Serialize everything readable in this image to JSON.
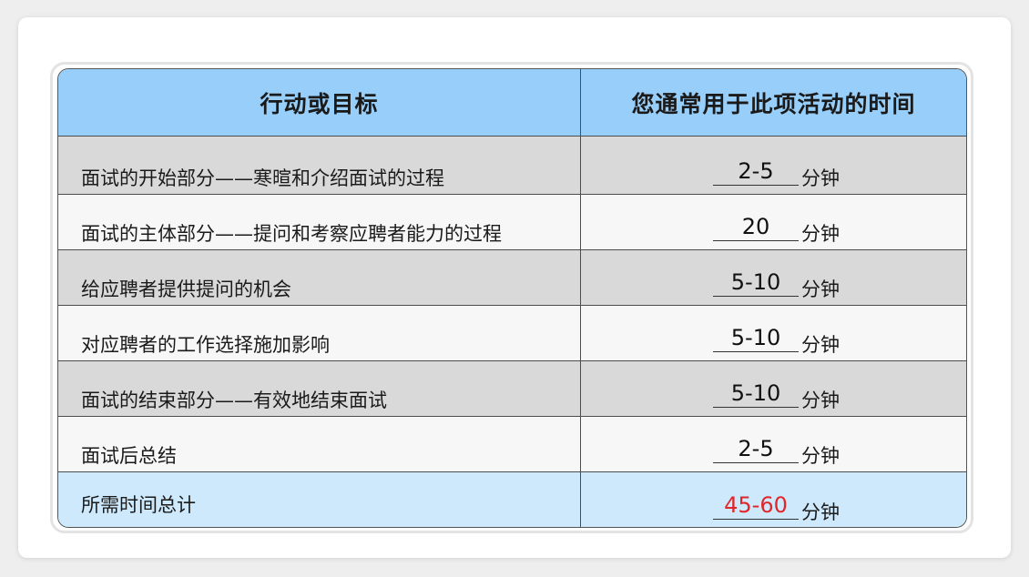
{
  "table": {
    "headers": {
      "action": "行动或目标",
      "time": "您通常用于此项活动的时间"
    },
    "rows": [
      {
        "action": "面试的开始部分——寒暄和介绍面试的过程",
        "time": "2-5",
        "unit": "分钟"
      },
      {
        "action": "面试的主体部分——提问和考察应聘者能力的过程",
        "time": "20",
        "unit": "分钟"
      },
      {
        "action": "给应聘者提供提问的机会",
        "time": "5-10",
        "unit": "分钟"
      },
      {
        "action": "对应聘者的工作选择施加影响",
        "time": "5-10",
        "unit": "分钟"
      },
      {
        "action": "面试的结束部分——有效地结束面试",
        "time": "5-10",
        "unit": "分钟"
      },
      {
        "action": "面试后总结",
        "time": "2-5",
        "unit": "分钟"
      }
    ],
    "total": {
      "action": "所需时间总计",
      "time": "45-60",
      "unit": "分钟"
    }
  },
  "colors": {
    "header_bg": "#98cffa",
    "shaded_row": "#d9d9d9",
    "plain_row": "#f7f7f7",
    "total_row": "#cde9fb",
    "total_value": "#e0262a"
  }
}
